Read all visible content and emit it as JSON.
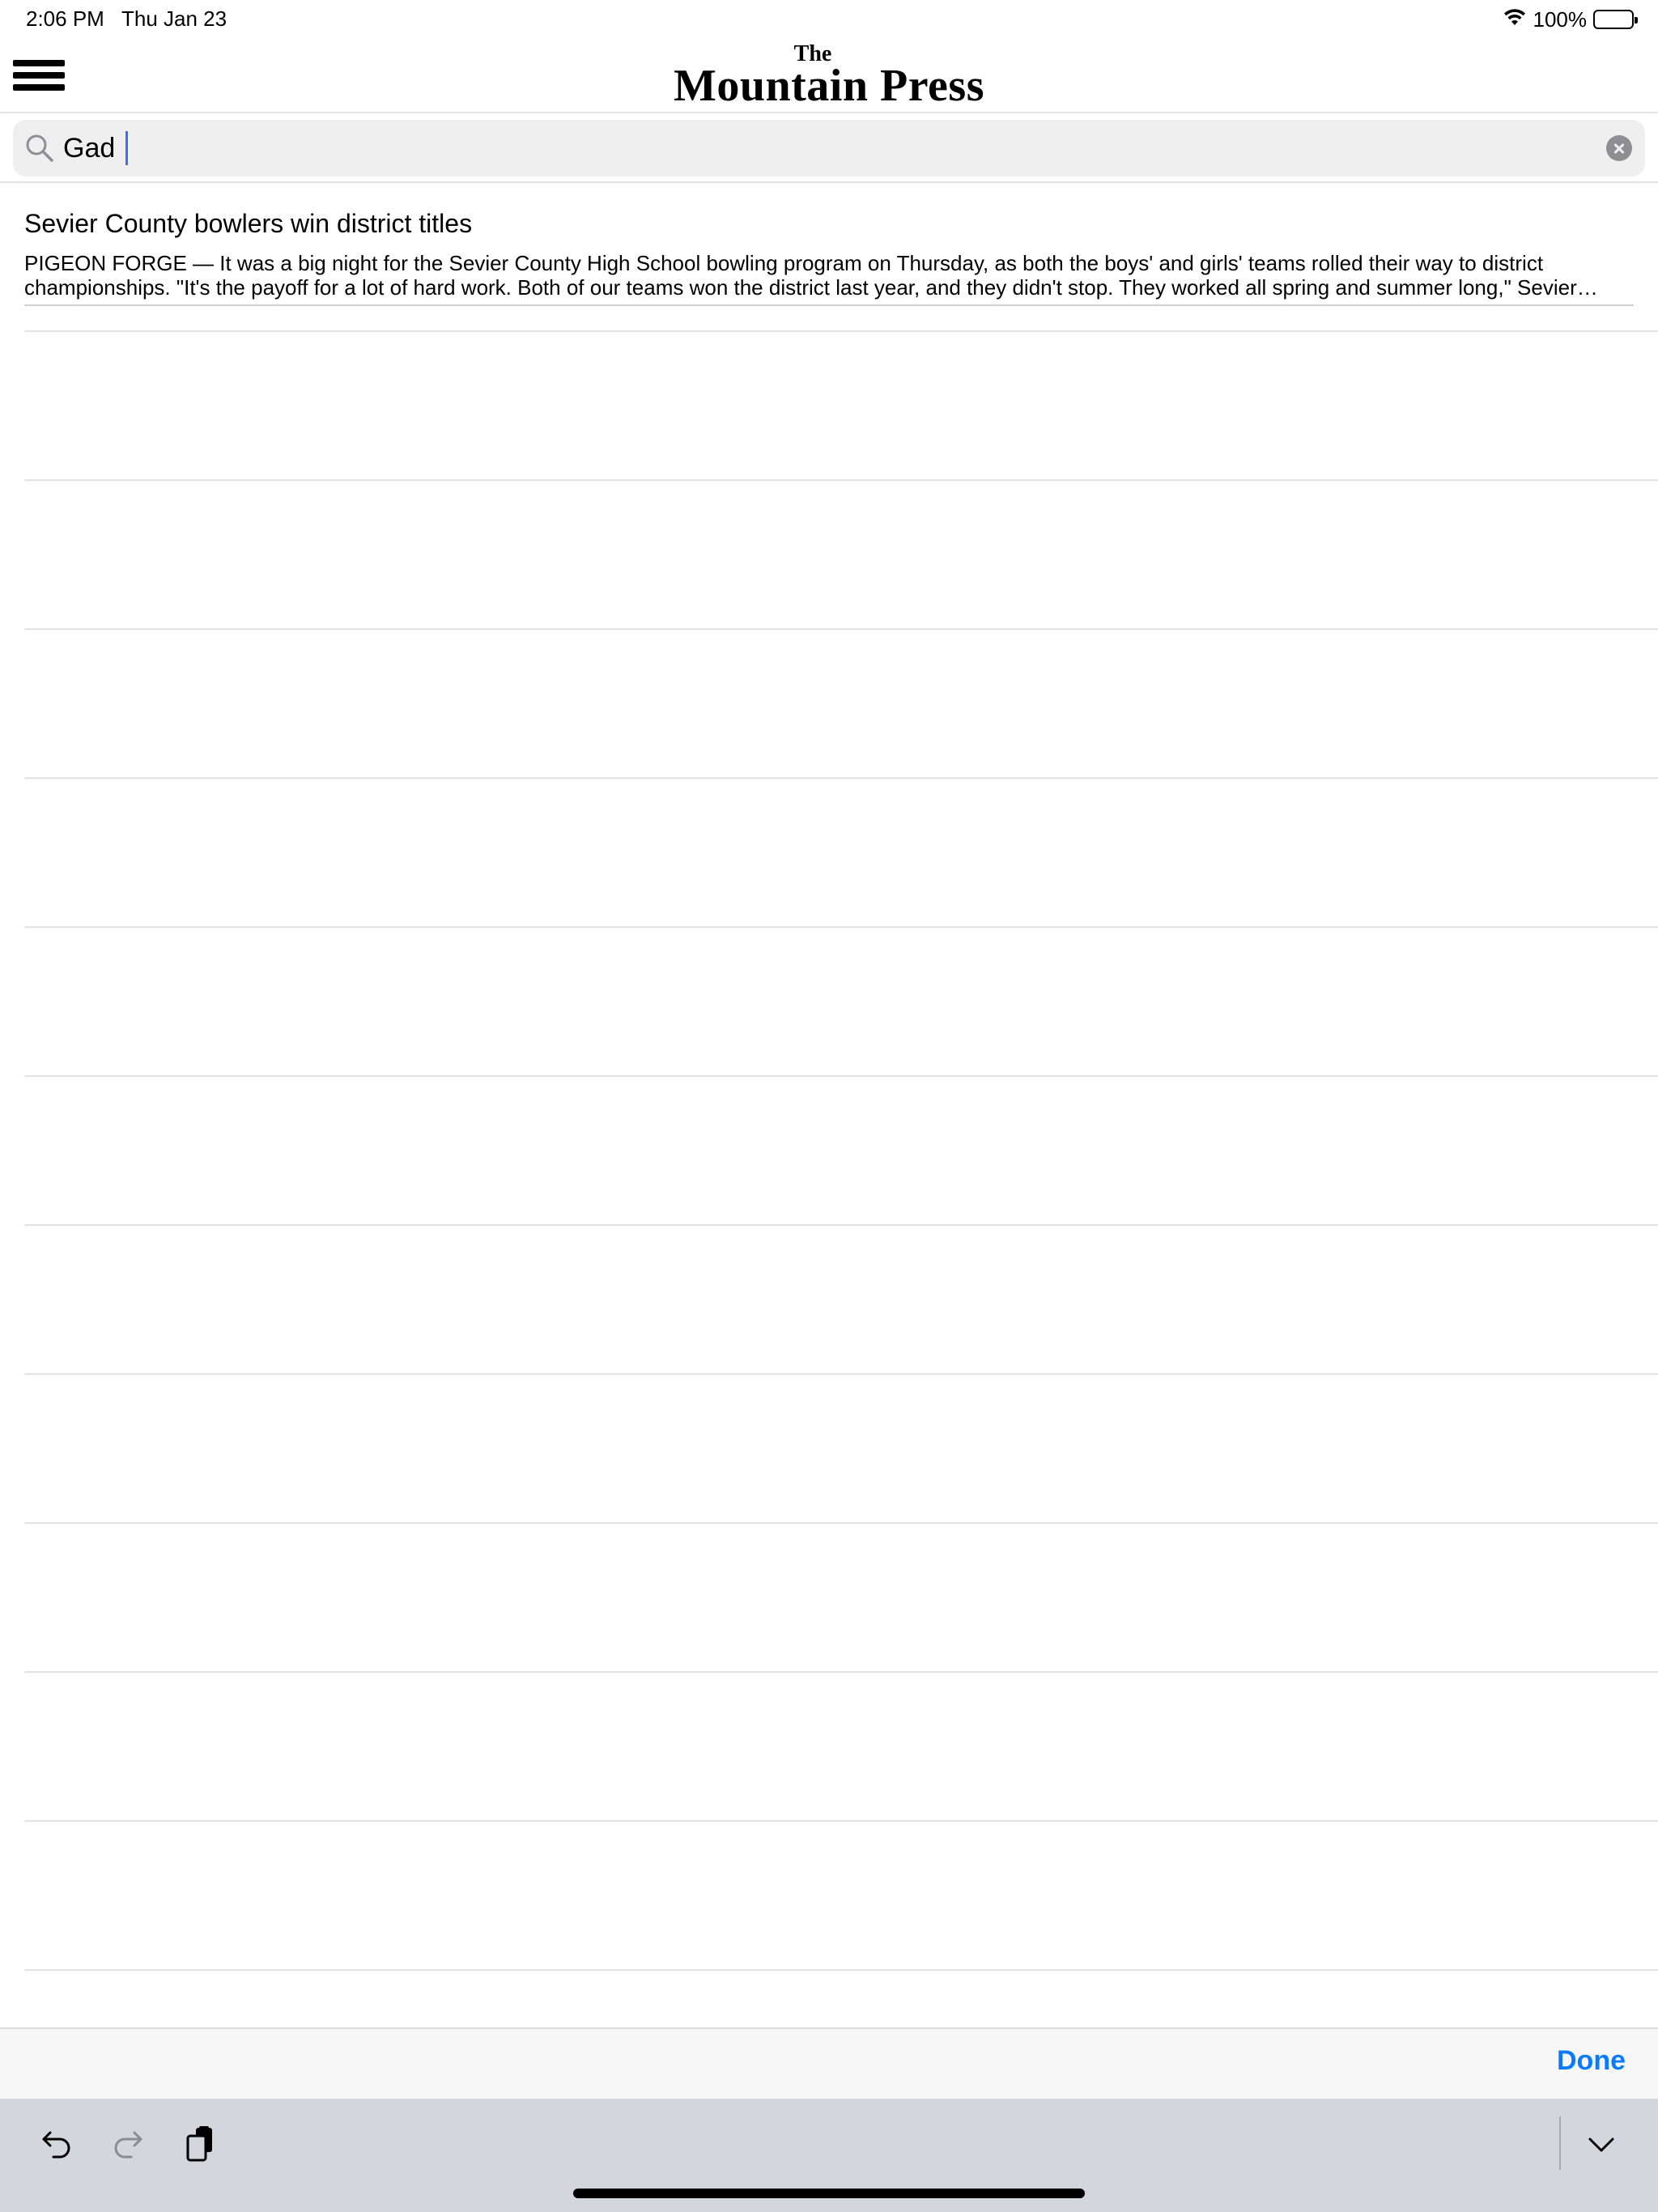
{
  "status_bar": {
    "time": "2:06 PM",
    "date": "Thu Jan 23",
    "battery": "100%",
    "battery_level": 1.0
  },
  "header": {
    "logo_top": "The",
    "logo_name": "Mountain Press",
    "menu_icon": "hamburger-icon"
  },
  "search": {
    "value": "Gad",
    "search_icon": "search-icon",
    "clear_icon": "clear-icon"
  },
  "results": [
    {
      "title": "Sevier County bowlers win district titles",
      "snippet_line1": "PIGEON FORGE — It was a big night for the Sevier County High School bowling program on Thursday, as both the boys' and girls' teams rolled their way to district",
      "snippet_line2": "championships. \"It's the payoff for a lot of hard work. Both of our teams won the district last year, and they didn't stop. They worked all spring and summer long,\" Sevier…"
    }
  ],
  "accessory": {
    "done_label": "Done",
    "accent_color": "#0a7aff"
  },
  "keyboard_bar": {
    "icons": [
      "undo-icon",
      "redo-icon",
      "paste-icon",
      "dismiss-keyboard-icon"
    ]
  }
}
